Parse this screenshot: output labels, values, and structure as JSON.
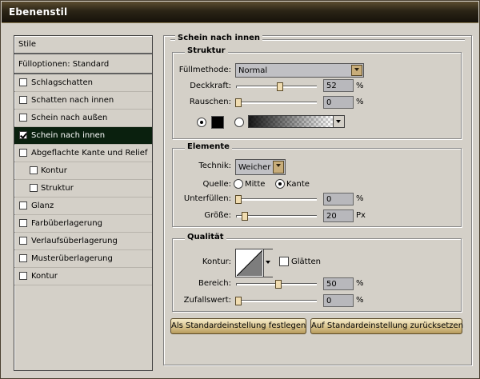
{
  "window": {
    "title": "Ebenenstil"
  },
  "sidebar": {
    "items": [
      {
        "label": "Stile",
        "checkbox": false
      },
      {
        "label": "Fülloptionen: Standard",
        "checkbox": false
      },
      {
        "label": "Schlagschatten",
        "checkbox": true,
        "checked": false
      },
      {
        "label": "Schatten nach innen",
        "checkbox": true,
        "checked": false
      },
      {
        "label": "Schein nach außen",
        "checkbox": true,
        "checked": false
      },
      {
        "label": "Schein nach innen",
        "checkbox": true,
        "checked": true,
        "selected": true
      },
      {
        "label": "Abgeflachte Kante und Relief",
        "checkbox": true,
        "checked": false
      },
      {
        "label": "Kontur",
        "checkbox": true,
        "checked": false,
        "indent": true
      },
      {
        "label": "Struktur",
        "checkbox": true,
        "checked": false,
        "indent": true
      },
      {
        "label": "Glanz",
        "checkbox": true,
        "checked": false
      },
      {
        "label": "Farbüberlagerung",
        "checkbox": true,
        "checked": false
      },
      {
        "label": "Verlaufsüberlagerung",
        "checkbox": true,
        "checked": false
      },
      {
        "label": "Musterüberlagerung",
        "checkbox": true,
        "checked": false
      },
      {
        "label": "Kontur",
        "checkbox": true,
        "checked": false
      }
    ]
  },
  "panel": {
    "title": "Schein nach innen",
    "struktur": {
      "title": "Struktur",
      "fuellmethode_label": "Füllmethode:",
      "fuellmethode_value": "Normal",
      "deckkraft_label": "Deckkraft:",
      "deckkraft_value": "52",
      "deckkraft_unit": "%",
      "deckkraft_level": 0.52,
      "rauschen_label": "Rauschen:",
      "rauschen_value": "0",
      "rauschen_unit": "%",
      "rauschen_level": 0,
      "color_mode": "solid",
      "solid_color": "#000000"
    },
    "elemente": {
      "title": "Elemente",
      "technik_label": "Technik:",
      "technik_value": "Weicher",
      "quelle_label": "Quelle:",
      "quelle_mitte": "Mitte",
      "quelle_kante": "Kante",
      "quelle_selected": "Kante",
      "unterfuellen_label": "Unterfüllen:",
      "unterfuellen_value": "0",
      "unterfuellen_unit": "%",
      "unterfuellen_level": 0,
      "groesse_label": "Größe:",
      "groesse_value": "20",
      "groesse_unit": "Px",
      "groesse_level": 0.08
    },
    "qualitaet": {
      "title": "Qualität",
      "kontur_label": "Kontur:",
      "glaetten_label": "Glätten",
      "glaetten_checked": false,
      "bereich_label": "Bereich:",
      "bereich_value": "50",
      "bereich_unit": "%",
      "bereich_level": 0.5,
      "zufallswert_label": "Zufallswert:",
      "zufallswert_value": "0",
      "zufallswert_unit": "%",
      "zufallswert_level": 0
    },
    "buttons": {
      "set_default": "Als Standardeinstellung festlegen",
      "reset_default": "Auf Standardeinstellung zurücksetzen"
    }
  },
  "colors": {
    "selected_bg": "#0a200e",
    "accent": "#c8ad7a"
  },
  "icons": {
    "checkbox": "check-icon",
    "dropdown": "chevron-down-icon"
  }
}
